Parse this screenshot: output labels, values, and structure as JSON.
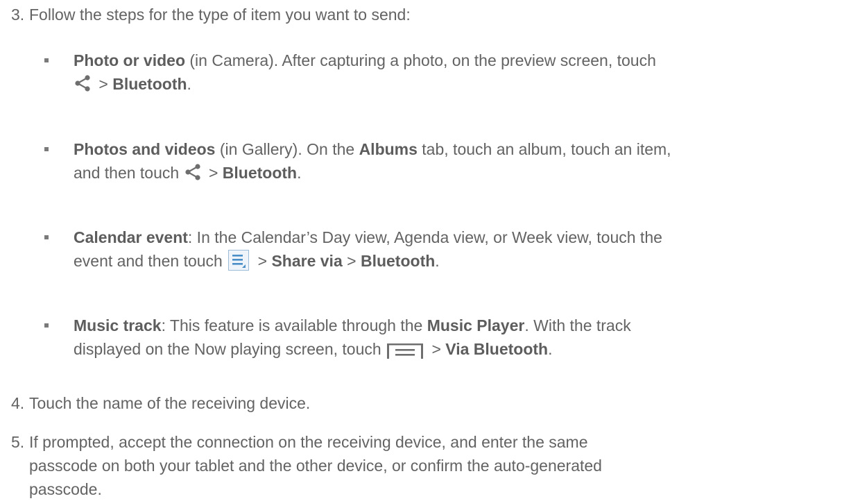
{
  "steps": [
    {
      "num": "3.",
      "text": "Follow the steps for the type of item you want to send:"
    },
    {
      "num": "4.",
      "text": "Touch the name of the receiving device."
    },
    {
      "num": "5.",
      "line1": "If prompted, accept the connection on the receiving device, and enter the same",
      "line2": "passcode on both your tablet and the other device, or confirm the auto-generated",
      "line3": "passcode."
    }
  ],
  "bullets": [
    {
      "title": "Photo or video",
      "t1": " (in Camera). After capturing a photo, on the preview screen, touch",
      "sep": " > ",
      "target": "Bluetooth",
      "end": "."
    },
    {
      "title": "Photos and videos",
      "t1": " (in Gallery). On the ",
      "b1": "Albums",
      "t2": " tab, touch an album, touch an item,",
      "t3": "and then touch ",
      "sep": " > ",
      "target": "Bluetooth",
      "end": "."
    },
    {
      "title": "Calendar event",
      "t1": ": In the Calendar’s Day view, Agenda view, or Week view, touch the",
      "t2": "event and then touch ",
      "sep1": " > ",
      "b1": "Share via",
      "sep2": " > ",
      "target": "Bluetooth",
      "end": "."
    },
    {
      "title": "Music track",
      "t1": ": This feature is available through the ",
      "b1": "Music Player",
      "t2": ". With the track",
      "t3": "displayed on the Now playing screen, touch ",
      "sep": " > ",
      "target": "Via Bluetooth",
      "end": "."
    }
  ],
  "icons": {
    "share": "share-icon",
    "menu": "menu-icon",
    "overflow": "overflow-menu-icon"
  },
  "colors": {
    "text": "#636363",
    "icon": "#6e6e6e",
    "menu_blue": "#4a8ec8"
  }
}
